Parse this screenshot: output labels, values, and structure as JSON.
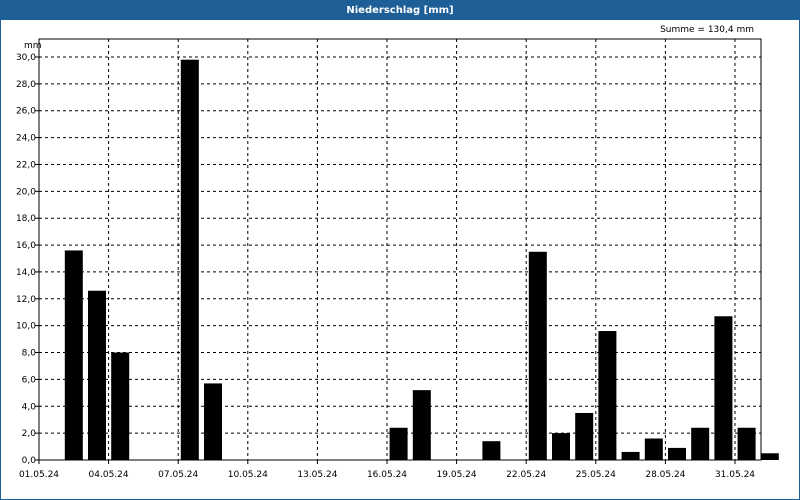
{
  "title": "Niederschlag [mm]",
  "summary": "Summe = 130,4 mm",
  "chart_data": {
    "type": "bar",
    "title": "Niederschlag [mm]",
    "ylabel": "mm",
    "xlabel": "",
    "ylim": [
      0,
      30
    ],
    "yticks": [
      0,
      2,
      4,
      6,
      8,
      10,
      12,
      14,
      16,
      18,
      20,
      22,
      24,
      26,
      28,
      30
    ],
    "ytick_labels": [
      "0,0",
      "2,0",
      "4,0",
      "6,0",
      "8,0",
      "10,0",
      "12,0",
      "14,0",
      "16,0",
      "18,0",
      "20,0",
      "22,0",
      "24,0",
      "26,0",
      "28,0",
      "30,0"
    ],
    "xticks": [
      "01.05.24",
      "04.05.24",
      "07.05.24",
      "10.05.24",
      "13.05.24",
      "16.05.24",
      "19.05.24",
      "22.05.24",
      "25.05.24",
      "28.05.24",
      "31.05.24"
    ],
    "grid": true,
    "categories": [
      "01.05.24",
      "02.05.24",
      "03.05.24",
      "04.05.24",
      "05.05.24",
      "06.05.24",
      "07.05.24",
      "08.05.24",
      "09.05.24",
      "10.05.24",
      "11.05.24",
      "12.05.24",
      "13.05.24",
      "14.05.24",
      "15.05.24",
      "16.05.24",
      "17.05.24",
      "18.05.24",
      "19.05.24",
      "20.05.24",
      "21.05.24",
      "22.05.24",
      "23.05.24",
      "24.05.24",
      "25.05.24",
      "26.05.24",
      "27.05.24",
      "28.05.24",
      "29.05.24",
      "30.05.24",
      "31.05.24"
    ],
    "values": [
      15.6,
      12.6,
      8.0,
      0,
      0,
      29.8,
      5.7,
      0,
      0,
      0,
      0,
      0,
      0,
      0,
      2.4,
      5.2,
      0,
      0,
      1.4,
      0,
      15.5,
      2.0,
      3.5,
      9.6,
      0.6,
      1.6,
      0.9,
      2.4,
      10.7,
      2.4,
      0.5
    ],
    "bar_color": "#000000"
  }
}
